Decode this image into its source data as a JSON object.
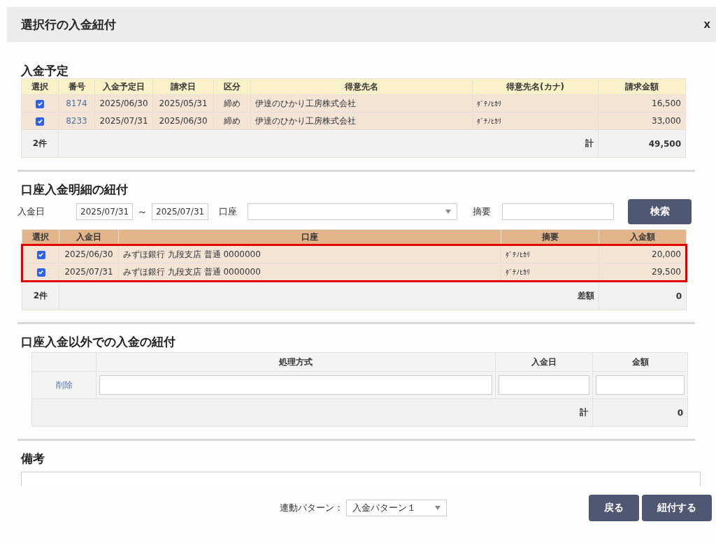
{
  "dialog": {
    "title": "選択行の入金紐付",
    "close": "x"
  },
  "scheduled": {
    "heading": "入金予定",
    "columns": [
      "選択",
      "番号",
      "入金予定日",
      "請求日",
      "区分",
      "得意先名",
      "得意先名(カナ)",
      "請求金額"
    ],
    "rows": [
      {
        "selected": true,
        "number": "8174",
        "due_date": "2025/06/30",
        "invoice_date": "2025/05/31",
        "category": "締め",
        "customer": "伊達のひかり工房株式会社",
        "customer_kana": "ﾀﾞﾃﾉﾋｶﾘ",
        "amount": "16,500"
      },
      {
        "selected": true,
        "number": "8233",
        "due_date": "2025/07/31",
        "invoice_date": "2025/06/30",
        "category": "締め",
        "customer": "伊達のひかり工房株式会社",
        "customer_kana": "ﾀﾞﾃﾉﾋｶﾘ",
        "amount": "33,000"
      }
    ],
    "footer": {
      "count": "2件",
      "total_label": "計",
      "total": "49,500"
    }
  },
  "payments": {
    "heading": "口座入金明細の紐付",
    "filters": {
      "date_label": "入金日",
      "date_from": "2025/07/31",
      "tilde": "～",
      "date_to": "2025/07/31",
      "account_label": "口座",
      "memo_label": "摘要",
      "search_button": "検索"
    },
    "columns": [
      "選択",
      "入金日",
      "口座",
      "摘要",
      "入金額"
    ],
    "rows": [
      {
        "selected": true,
        "highlighted": true,
        "date": "2025/06/30",
        "account": "みずほ銀行 九段支店 普通 0000000",
        "memo": "ﾀﾞﾃﾉﾋｶﾘ",
        "amount": "20,000"
      },
      {
        "selected": true,
        "highlighted": true,
        "date": "2025/07/31",
        "account": "みずほ銀行 九段支店 普通 0000000",
        "memo": "ﾀﾞﾃﾉﾋｶﾘ",
        "amount": "29,500"
      }
    ],
    "footer": {
      "count": "2件",
      "diff_label": "差額",
      "diff": "0"
    }
  },
  "other": {
    "heading": "口座入金以外での入金の紐付",
    "columns": [
      "処理方式",
      "入金日",
      "金額"
    ],
    "rows": [
      {
        "delete_link": "削除"
      }
    ],
    "footer": {
      "total_label": "計",
      "total": "0"
    }
  },
  "notes": {
    "heading": "備考"
  },
  "footer": {
    "pattern_label": "連動パターン：",
    "pattern_value": "入金パターン１",
    "buttons": [
      "戻る",
      "紐付する"
    ]
  }
}
